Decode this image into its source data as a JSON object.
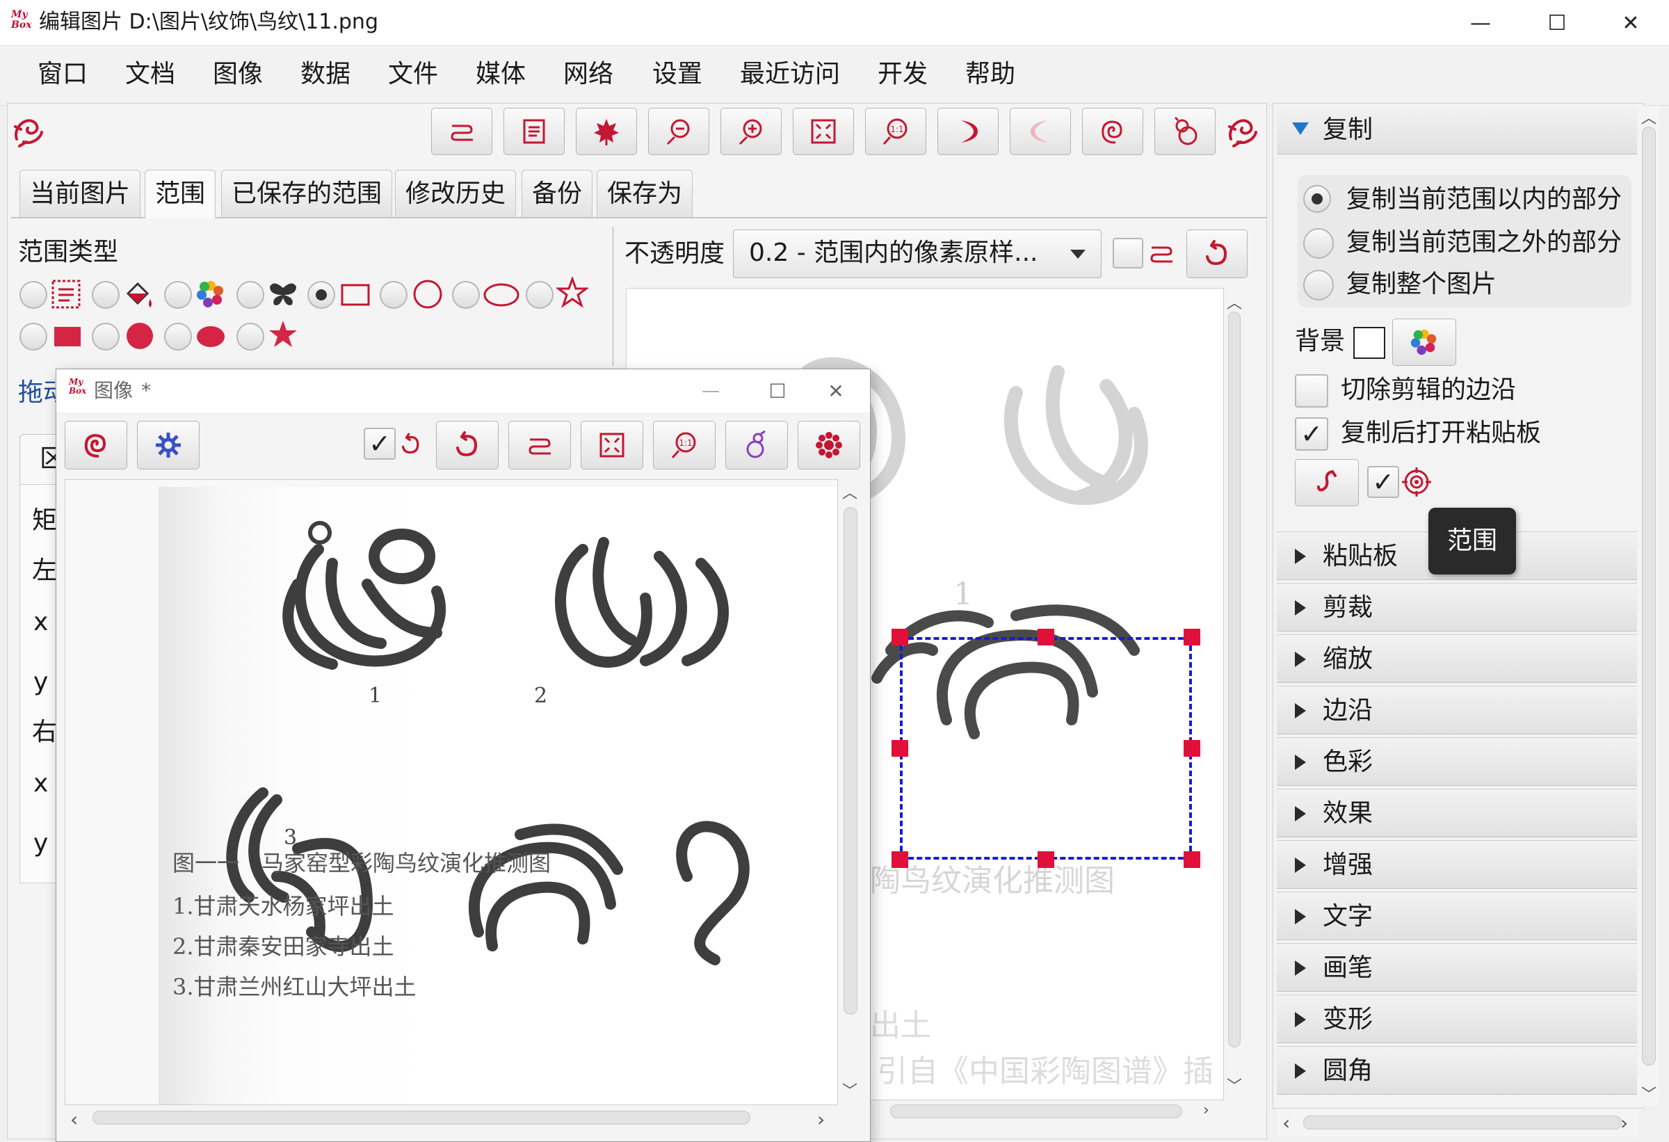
{
  "window": {
    "title": "编辑图片 D:\\图片\\纹饰\\鸟纹\\11.png",
    "logo_text": "My Box",
    "minimize_glyph": "—",
    "maximize_glyph": "☐",
    "close_glyph": "✕"
  },
  "menu": [
    "窗口",
    "文档",
    "图像",
    "数据",
    "文件",
    "媒体",
    "网络",
    "设置",
    "最近访问",
    "开发",
    "帮助"
  ],
  "toolbar": {
    "icons": [
      "pop-icon",
      "text-icon",
      "leaf-icon",
      "zoom-out-icon",
      "zoom-in-icon",
      "fit-window-icon",
      "original-size-icon",
      "rotate-right-icon",
      "rotate-left-icon",
      "spiral-icon",
      "gourd-icon"
    ]
  },
  "tabs": [
    "当前图片",
    "范围",
    "已保存的范围",
    "修改历史",
    "备份",
    "保存为"
  ],
  "active_tab": "范围",
  "scope": {
    "type_label": "范围类型",
    "drag_label": "拖动",
    "sub_tab_label": "区",
    "coord_labels": [
      "矩",
      "左",
      "x",
      "y",
      "右",
      "x",
      "y"
    ]
  },
  "opacity": {
    "label": "不透明度",
    "value": "0.2 - 范围内的像素原样..."
  },
  "preview": {
    "caption_number_1": "1",
    "caption_text": "陶鸟纹演化推测图",
    "caption_line_earth": "出土",
    "caption_cite": "引自《中国彩陶图谱》插"
  },
  "popup": {
    "title": "图像",
    "title_suffix": "*",
    "logo_text": "My Box",
    "figure_numbers": [
      "1",
      "2",
      "3"
    ],
    "caption_title": "图一一　马家窑型彩陶鸟纹演化推测图",
    "caption_lines": [
      "1.甘肃天水杨家坪出土",
      "2.甘肃秦安田家寺出土",
      "3.甘肃兰州红山大坪出土"
    ]
  },
  "right_panel": {
    "copy_section": "复制",
    "copy_options": [
      "复制当前范围以内的部分",
      "复制当前范围之外的部分",
      "复制整个图片"
    ],
    "copy_selected": 0,
    "background_label": "背景",
    "cut_margins_label": "切除剪辑的边沿",
    "cut_margins_checked": false,
    "open_clipboard_label": "复制后打开粘贴板",
    "open_clipboard_checked": true,
    "tooltip": "范围",
    "sections": [
      "粘贴板",
      "剪裁",
      "缩放",
      "边沿",
      "色彩",
      "效果",
      "增强",
      "文字",
      "画笔",
      "变形",
      "圆角"
    ]
  },
  "colors": {
    "accent": "#c41732",
    "selection": "#1a1adc",
    "handle": "#e0103a"
  }
}
